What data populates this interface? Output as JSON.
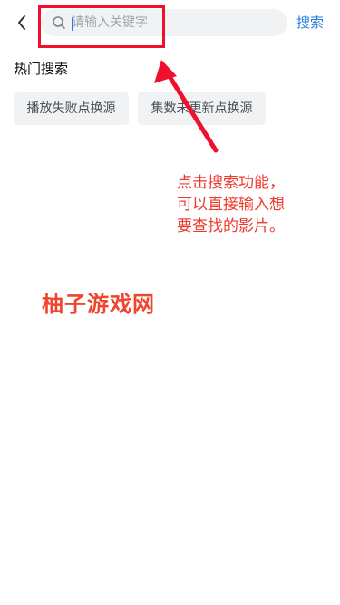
{
  "header": {
    "search_placeholder": "请输入关键字",
    "search_button": "搜索"
  },
  "hot_search": {
    "title": "热门搜索",
    "tags": [
      "播放失败点换源",
      "集数未更新点换源"
    ]
  },
  "annotation": {
    "lines": [
      "点击搜索功能，",
      "可以直接输入想",
      "要查找的影片。"
    ],
    "color": "#ec3a2d"
  },
  "watermark": {
    "text": "柚子游戏网",
    "color": "#f0452c"
  },
  "colors": {
    "accent": "#1f7ad9",
    "annotation_red": "#f0102e",
    "search_bg": "#f1f2f4"
  },
  "icons": {
    "back": "chevron-left-icon",
    "search": "search-icon"
  }
}
